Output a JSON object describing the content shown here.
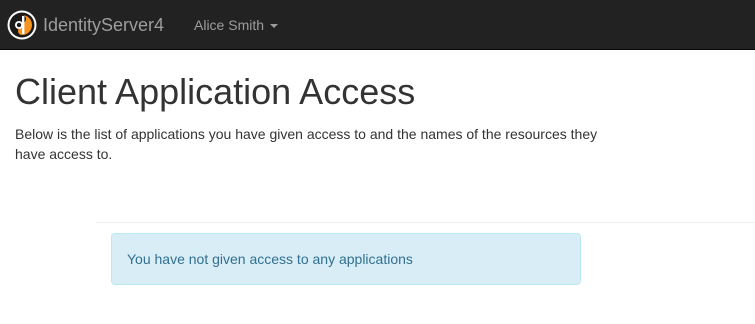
{
  "navbar": {
    "brand_name": "IdentityServer4",
    "user_name": "Alice Smith",
    "logo_icon": "identityserver-logo-icon",
    "dropdown_icon": "caret-down-icon"
  },
  "main": {
    "title": "Client Application Access",
    "description": "Below is the list of applications you have given access to and the names of the resources they have access to.",
    "empty_message": "You have not given access to any applications"
  },
  "colors": {
    "navbar_bg": "#222222",
    "navbar_text": "#9d9d9d",
    "logo_orange": "#f7941d",
    "alert_bg": "#d9edf7",
    "alert_border": "#bce8f1",
    "alert_text": "#31708f"
  }
}
